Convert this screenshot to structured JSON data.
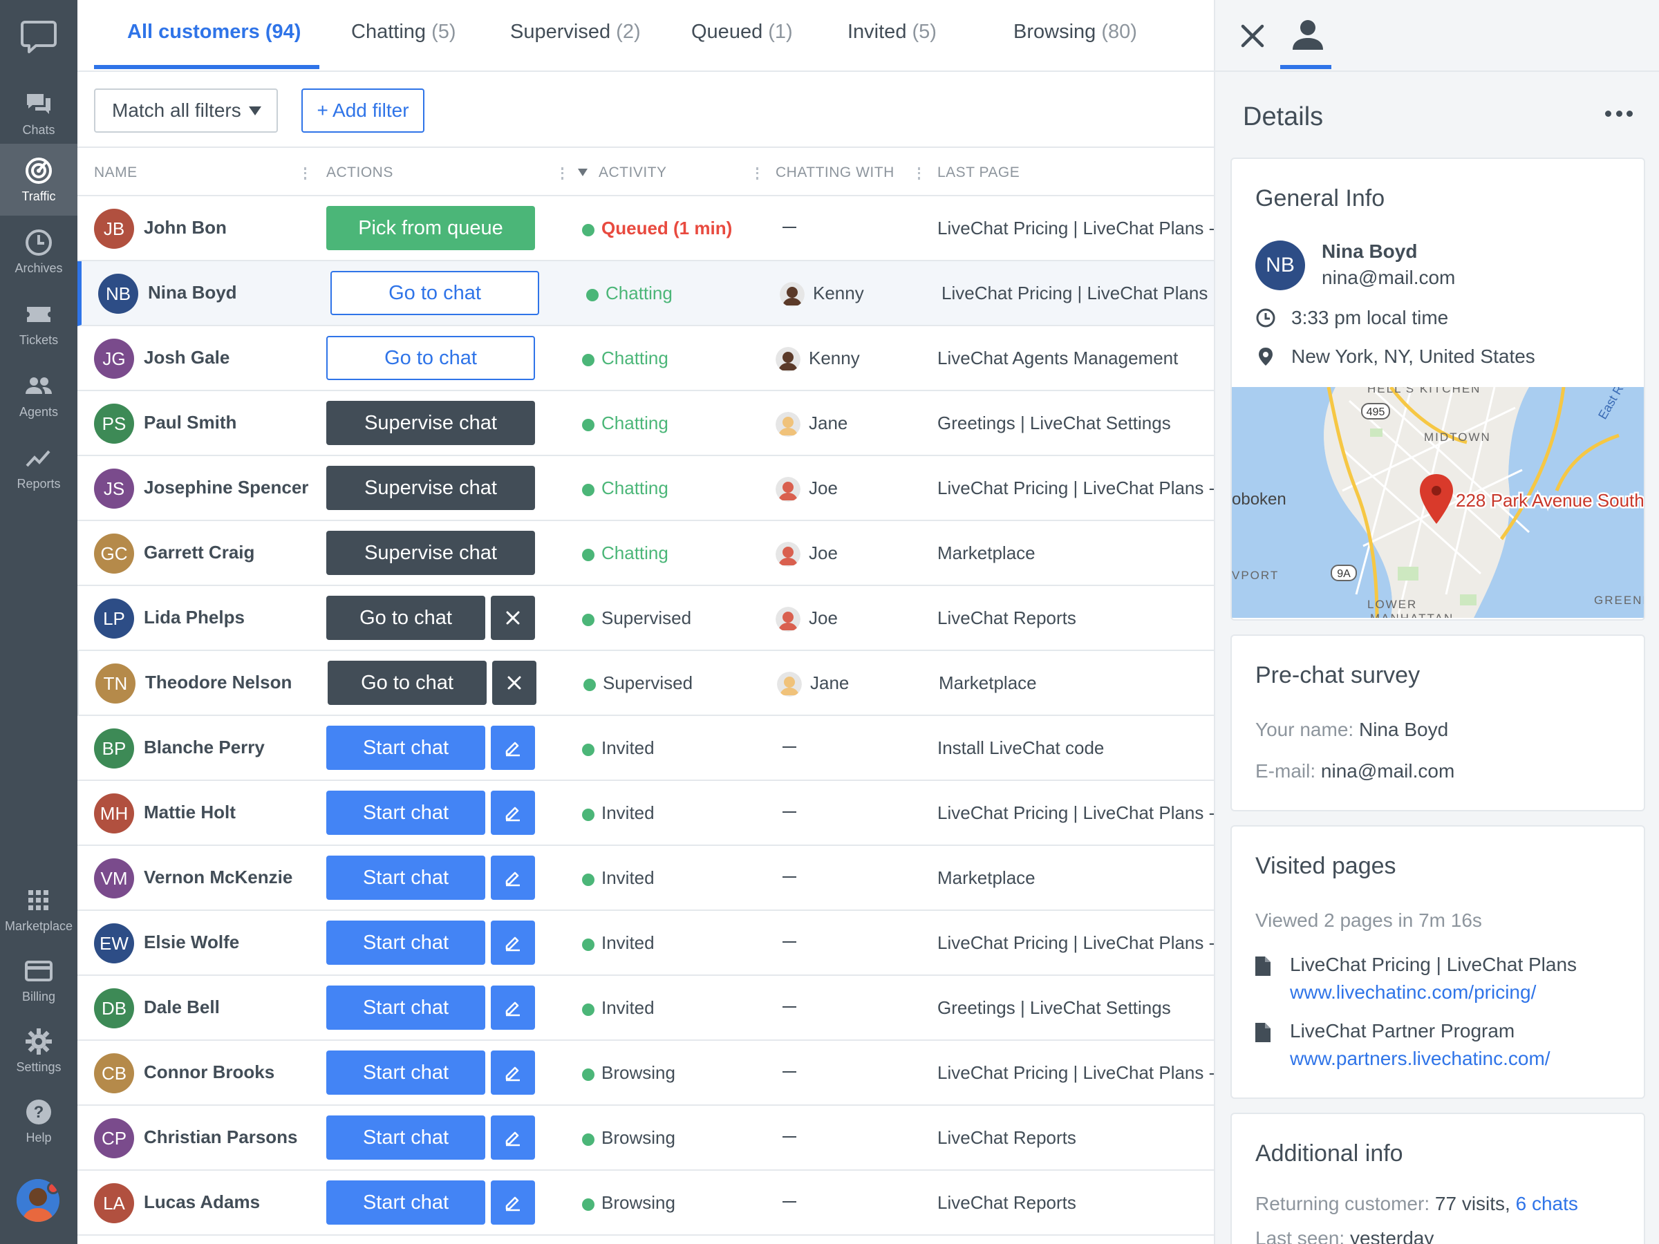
{
  "nav": {
    "items": [
      {
        "label": "Chats",
        "icon": "chats-icon"
      },
      {
        "label": "Traffic",
        "icon": "traffic-icon"
      },
      {
        "label": "Archives",
        "icon": "archives-icon"
      },
      {
        "label": "Tickets",
        "icon": "tickets-icon"
      },
      {
        "label": "Agents",
        "icon": "agents-icon"
      },
      {
        "label": "Reports",
        "icon": "reports-icon"
      },
      {
        "label": "Marketplace",
        "icon": "marketplace-icon"
      },
      {
        "label": "Billing",
        "icon": "billing-icon"
      },
      {
        "label": "Settings",
        "icon": "settings-icon"
      },
      {
        "label": "Help",
        "icon": "help-icon"
      }
    ]
  },
  "tabs": [
    {
      "label": "All customers",
      "count": "(94)"
    },
    {
      "label": "Chatting",
      "count": "(5)"
    },
    {
      "label": "Supervised",
      "count": "(2)"
    },
    {
      "label": "Queued",
      "count": "(1)"
    },
    {
      "label": "Invited",
      "count": "(5)"
    },
    {
      "label": "Browsing",
      "count": "(80)"
    }
  ],
  "filters": {
    "match": "Match all filters",
    "add": "+ Add filter"
  },
  "columns": {
    "name": "NAME",
    "actions": "ACTIONS",
    "activity": "ACTIVITY",
    "chatting_with": "CHATTING WITH",
    "last_page": "LAST PAGE"
  },
  "dash": "—",
  "rows": [
    {
      "initials": "JB",
      "name": "John Bon",
      "action": "Pick from queue",
      "status": "Queued (1 min)",
      "chatting_with": "",
      "last_page": "LiveChat Pricing | LiveChat Plans - Customer service"
    },
    {
      "initials": "NB",
      "name": "Nina Boyd",
      "action": "Go to chat",
      "status": "Chatting",
      "chatting_with": "Kenny",
      "last_page": "LiveChat Pricing | LiveChat Plans"
    },
    {
      "initials": "JG",
      "name": "Josh Gale",
      "action": "Go to chat",
      "status": "Chatting",
      "chatting_with": "Kenny",
      "last_page": "LiveChat Agents Management"
    },
    {
      "initials": "PS",
      "name": "Paul Smith",
      "action": "Supervise chat",
      "status": "Chatting",
      "chatting_with": "Jane",
      "last_page": "Greetings | LiveChat Settings"
    },
    {
      "initials": "JS",
      "name": "Josephine Spencer",
      "action": "Supervise chat",
      "status": "Chatting",
      "chatting_with": "Joe",
      "last_page": "LiveChat Pricing | LiveChat Plans - Customer service"
    },
    {
      "initials": "GC",
      "name": "Garrett Craig",
      "action": "Supervise chat",
      "status": "Chatting",
      "chatting_with": "Joe",
      "last_page": "Marketplace"
    },
    {
      "initials": "LP",
      "name": "Lida Phelps",
      "action": "Go to chat",
      "status": "Supervised",
      "chatting_with": "Joe",
      "last_page": "LiveChat Reports"
    },
    {
      "initials": "TN",
      "name": "Theodore Nelson",
      "action": "Go to chat",
      "status": "Supervised",
      "chatting_with": "Jane",
      "last_page": "Marketplace"
    },
    {
      "initials": "BP",
      "name": "Blanche Perry",
      "action": "Start chat",
      "status": "Invited",
      "chatting_with": "",
      "last_page": "Install LiveChat code"
    },
    {
      "initials": "MH",
      "name": "Mattie Holt",
      "action": "Start chat",
      "status": "Invited",
      "chatting_with": "",
      "last_page": "LiveChat Pricing | LiveChat Plans - Customer service"
    },
    {
      "initials": "VM",
      "name": "Vernon McKenzie",
      "action": "Start chat",
      "status": "Invited",
      "chatting_with": "",
      "last_page": "Marketplace"
    },
    {
      "initials": "EW",
      "name": "Elsie Wolfe",
      "action": "Start chat",
      "status": "Invited",
      "chatting_with": "",
      "last_page": "LiveChat Pricing | LiveChat Plans - Customer service"
    },
    {
      "initials": "DB",
      "name": "Dale Bell",
      "action": "Start chat",
      "status": "Invited",
      "chatting_with": "",
      "last_page": "Greetings | LiveChat Settings"
    },
    {
      "initials": "CB",
      "name": "Connor Brooks",
      "action": "Start chat",
      "status": "Browsing",
      "chatting_with": "",
      "last_page": "LiveChat Pricing | LiveChat Plans - Customer service"
    },
    {
      "initials": "CP",
      "name": "Christian Parsons",
      "action": "Start chat",
      "status": "Browsing",
      "chatting_with": "",
      "last_page": "LiveChat Reports"
    },
    {
      "initials": "LA",
      "name": "Lucas Adams",
      "action": "Start chat",
      "status": "Browsing",
      "chatting_with": "",
      "last_page": "LiveChat Reports"
    }
  ],
  "details": {
    "title": "Details",
    "general": {
      "heading": "General Info",
      "initials": "NB",
      "name": "Nina Boyd",
      "email": "nina@mail.com",
      "local_time": "3:33 pm local time",
      "location": "New York, NY, United States",
      "map_labels": {
        "hells_kitchen": "HELL'S KITCHEN",
        "midtown": "MIDTOWN",
        "hoboken": "oboken",
        "port": "VPORT",
        "lower": "LOWER",
        "manhattan": "MANHATTAN",
        "greenpoint": "GREENP",
        "east_river": "East Ri",
        "shield_495": "495",
        "shield_9a": "9A",
        "pin": "228 Park Avenue South"
      }
    },
    "survey": {
      "heading": "Pre-chat survey",
      "name_key": "Your name:",
      "name_val": "Nina Boyd",
      "email_key": "E-mail:",
      "email_val": "nina@mail.com"
    },
    "visited": {
      "heading": "Visited pages",
      "summary": "Viewed 2 pages in 7m 16s",
      "pages": [
        {
          "title": "LiveChat Pricing | LiveChat Plans",
          "url": "www.livechatinc.com/pricing/"
        },
        {
          "title": "LiveChat Partner Program",
          "url": "www.partners.livechatinc.com/"
        }
      ]
    },
    "additional": {
      "heading": "Additional info",
      "returning_key": "Returning customer:",
      "returning_val": "77 visits,",
      "returning_link": "6 chats",
      "last_seen_key": "Last seen:",
      "last_seen_val": "yesterday"
    }
  },
  "colors": {
    "accent": "#2f74e8",
    "nav_bg": "#424d57",
    "green": "#4bb678",
    "queued_red": "#e84a3f",
    "start_blue": "#4384f5"
  }
}
